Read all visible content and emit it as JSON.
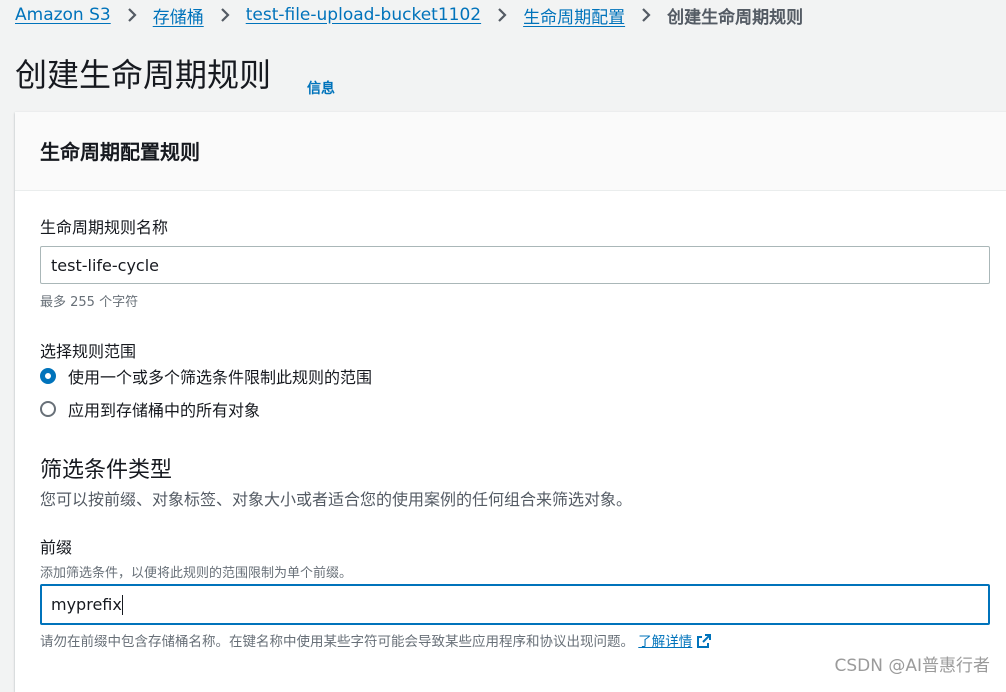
{
  "breadcrumb": {
    "items": [
      "Amazon S3",
      "存储桶",
      "test-file-upload-bucket1102",
      "生命周期配置"
    ],
    "current": "创建生命周期规则"
  },
  "page": {
    "title": "创建生命周期规则",
    "info_link": "信息"
  },
  "panel": {
    "title": "生命周期配置规则",
    "rule_name": {
      "label": "生命周期规则名称",
      "value": "test-life-cycle",
      "hint": "最多 255 个字符"
    },
    "scope": {
      "label": "选择规则范围",
      "options": [
        "使用一个或多个筛选条件限制此规则的范围",
        "应用到存储桶中的所有对象"
      ],
      "selected_index": 0
    },
    "filter_type": {
      "title": "筛选条件类型",
      "description": "您可以按前缀、对象标签、对象大小或者适合您的使用案例的任何组合来筛选对象。"
    },
    "prefix": {
      "label": "前缀",
      "description": "添加筛选条件，以便将此规则的范围限制为单个前缀。",
      "value": "myprefix",
      "warning": "请勿在前缀中包含存储桶名称。在键名称中使用某些字符可能会导致某些应用程序和协议出现问题。",
      "learn_more": "了解详情"
    }
  },
  "watermark": "CSDN @AI普惠行者",
  "colors": {
    "link": "#0073bb",
    "page_bg": "#f2f3f3",
    "hint_text": "#687078"
  },
  "icons": {
    "breadcrumb_separator": "chevron-right-icon",
    "external_link": "external-link-icon"
  }
}
